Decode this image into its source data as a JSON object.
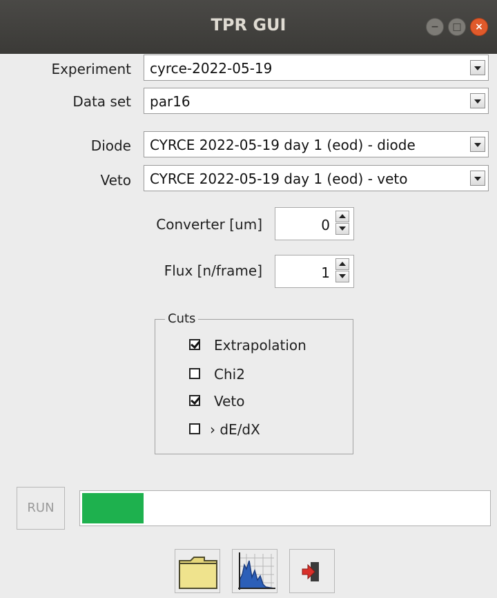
{
  "window": {
    "title": "TPR GUI",
    "buttons": [
      "minimize",
      "maximize",
      "close"
    ]
  },
  "form": {
    "experiment_label": "Experiment",
    "experiment_value": "cyrce-2022-05-19",
    "dataset_label": "Data set",
    "dataset_value": "par16",
    "diode_label": "Diode",
    "diode_value": "CYRCE 2022-05-19 day 1 (eod) - diode",
    "veto_label": "Veto",
    "veto_value": "CYRCE 2022-05-19 day 1 (eod) - veto",
    "converter_label": "Converter [um]",
    "converter_value": "0",
    "flux_label": "Flux [n/frame]",
    "flux_value": "1"
  },
  "cuts": {
    "legend": "Cuts",
    "items": [
      {
        "label": "Extrapolation",
        "checked": true
      },
      {
        "label": "Chi2",
        "checked": false
      },
      {
        "label": "Veto",
        "checked": true
      },
      {
        "label": "› dE/dX",
        "checked": false
      }
    ]
  },
  "run": {
    "label": "RUN",
    "progress": 0.15,
    "progress_color": "#1eb14e"
  },
  "toolbar": {
    "icons": [
      "folder-icon",
      "histogram-icon",
      "exit-icon"
    ]
  }
}
